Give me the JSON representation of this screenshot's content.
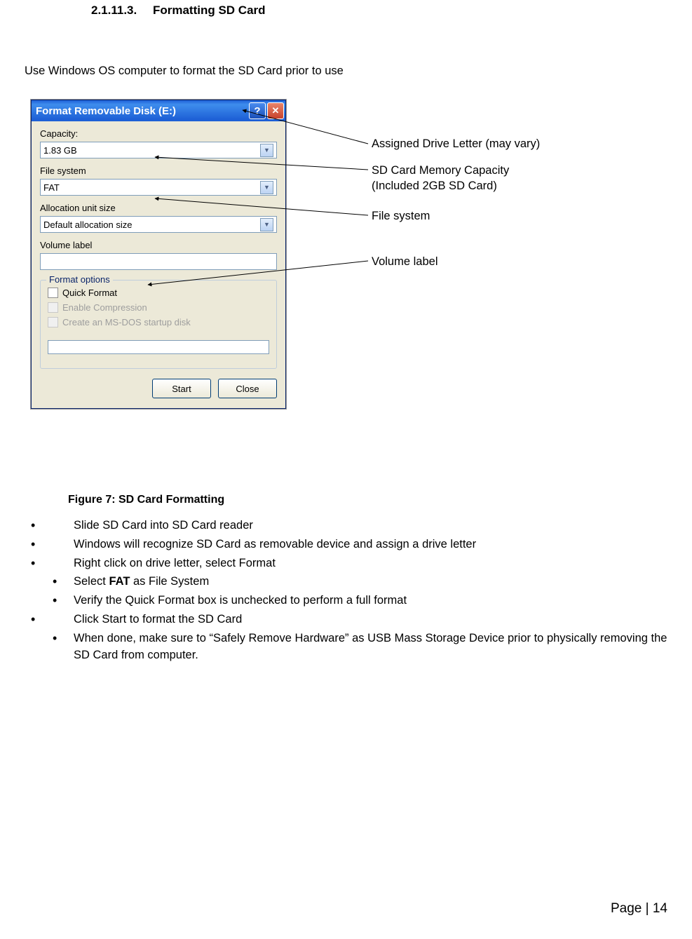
{
  "sectionNumber": "2.1.11.3.",
  "sectionTitle": "Formatting SD Card",
  "intro": "Use Windows OS computer to format the SD Card prior to use",
  "dialog": {
    "title": "Format Removable Disk (E:)",
    "capacityLabel": "Capacity:",
    "capacityValue": "1.83 GB",
    "fsLabel": "File system",
    "fsValue": "FAT",
    "allocLabel": "Allocation unit size",
    "allocValue": "Default allocation size",
    "volLabel": "Volume label",
    "volValue": "",
    "optionsTitle": "Format options",
    "opt1": "Quick Format",
    "opt2": "Enable Compression",
    "opt3": "Create an MS-DOS startup disk",
    "startBtn": "Start",
    "closeBtn": "Close"
  },
  "figureCaption": "Figure 7: SD Card Formatting",
  "callouts": {
    "drive": "Assigned Drive Letter (may vary)",
    "capacity1": "SD Card Memory Capacity",
    "capacity2": "(Included 2GB SD Card)",
    "fs": "File system",
    "vol": "Volume label"
  },
  "steps": {
    "s1": "Slide SD Card into SD Card reader",
    "s2": "Windows will recognize SD Card as removable device and assign a drive letter",
    "s3": "Right click on drive letter, select Format",
    "s4_pre": "Select ",
    "s4_b": "FAT",
    "s4_post": " as File System",
    "s5": "Verify the Quick Format box is unchecked to perform a full format",
    "s6": "Click Start to format the SD Card",
    "s7": "When done, make sure to “Safely Remove Hardware” as USB Mass Storage Device prior to physically removing the SD Card from computer."
  },
  "footer": "Page |  14"
}
